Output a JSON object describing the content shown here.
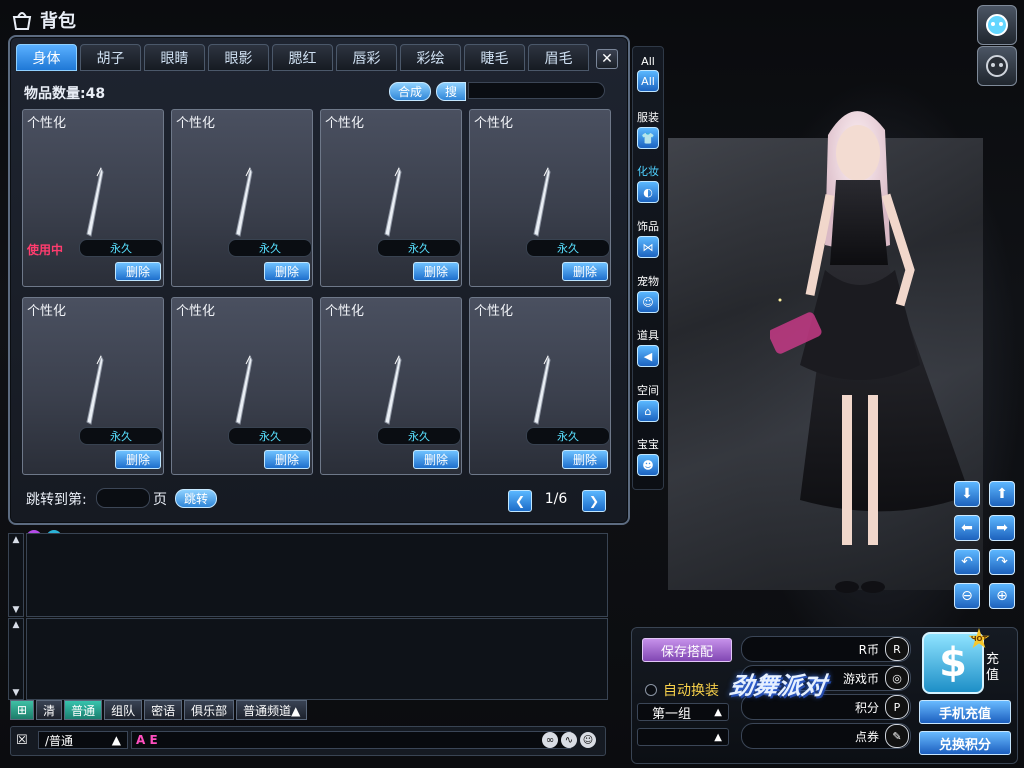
{
  "window": {
    "title": "背包"
  },
  "tabs": [
    {
      "label": "身体",
      "active": true
    },
    {
      "label": "胡子",
      "active": false
    },
    {
      "label": "眼睛",
      "active": false
    },
    {
      "label": "眼影",
      "active": false
    },
    {
      "label": "腮红",
      "active": false
    },
    {
      "label": "唇彩",
      "active": false
    },
    {
      "label": "彩绘",
      "active": false
    },
    {
      "label": "睫毛",
      "active": false
    },
    {
      "label": "眉毛",
      "active": false
    }
  ],
  "close_glyph": "✕",
  "item_count": "物品数量:48",
  "toolbar": {
    "combine": "合成",
    "search": "搜"
  },
  "items": [
    {
      "label": "个性化",
      "status": "使用中",
      "duration": "永久",
      "delete": "删除"
    },
    {
      "label": "个性化",
      "status": "",
      "duration": "永久",
      "delete": "删除"
    },
    {
      "label": "个性化",
      "status": "",
      "duration": "永久",
      "delete": "删除"
    },
    {
      "label": "个性化",
      "status": "",
      "duration": "永久",
      "delete": "删除"
    },
    {
      "label": "个性化",
      "status": "",
      "duration": "永久",
      "delete": "删除"
    },
    {
      "label": "个性化",
      "status": "",
      "duration": "永久",
      "delete": "删除"
    },
    {
      "label": "个性化",
      "status": "",
      "duration": "永久",
      "delete": "删除"
    },
    {
      "label": "个性化",
      "status": "",
      "duration": "永久",
      "delete": "删除"
    }
  ],
  "pagination": {
    "jump_label": "跳转到第:",
    "page_unit": "页",
    "jump_button": "跳转",
    "indicator": "1/6"
  },
  "categories": [
    {
      "label": "All",
      "icon": "all-icon",
      "glyph": "All",
      "active": false
    },
    {
      "label": "服装",
      "icon": "shirt-icon",
      "glyph": "👕",
      "active": false
    },
    {
      "label": "化妆",
      "icon": "makeup-icon",
      "glyph": "◐",
      "active": true
    },
    {
      "label": "饰品",
      "icon": "bow-icon",
      "glyph": "⋈",
      "active": false
    },
    {
      "label": "宠物",
      "icon": "pet-icon",
      "glyph": "☺",
      "active": false
    },
    {
      "label": "道具",
      "icon": "megaphone-icon",
      "glyph": "◀",
      "active": false
    },
    {
      "label": "空间",
      "icon": "house-icon",
      "glyph": "⌂",
      "active": false
    },
    {
      "label": "宝宝",
      "icon": "baby-icon",
      "glyph": "☻",
      "active": false
    }
  ],
  "camera_controls": [
    {
      "name": "move-down",
      "glyph": "⬇"
    },
    {
      "name": "move-up",
      "glyph": "⬆"
    },
    {
      "name": "move-left",
      "glyph": "⬅"
    },
    {
      "name": "move-right",
      "glyph": "➡"
    },
    {
      "name": "rotate-left",
      "glyph": "↶"
    },
    {
      "name": "rotate-right",
      "glyph": "↷"
    },
    {
      "name": "zoom-out",
      "glyph": "⊖"
    },
    {
      "name": "zoom-in",
      "glyph": "⊕"
    }
  ],
  "chat": {
    "tabs": [
      {
        "label": "清",
        "active": false
      },
      {
        "label": "普通",
        "active": true
      },
      {
        "label": "组队",
        "active": false
      },
      {
        "label": "密语",
        "active": false
      },
      {
        "label": "俱乐部",
        "active": false
      },
      {
        "label": "普通频道▲",
        "active": false
      }
    ],
    "channel": "/普通",
    "channel_arrow": "▲",
    "input_markers": "A E"
  },
  "outfit": {
    "save_button": "保存搭配",
    "auto_dress": "自动换装",
    "group_select": "第一组",
    "group_arrow": "▲"
  },
  "currencies": [
    {
      "label": "R币",
      "icon": "rcoin-icon",
      "glyph": "R"
    },
    {
      "label": "游戏币",
      "icon": "gamecoin-icon",
      "glyph": "◎"
    },
    {
      "label": "积分",
      "icon": "points-icon",
      "glyph": "P"
    },
    {
      "label": "点券",
      "icon": "voucher-icon",
      "glyph": "✎"
    }
  ],
  "recharge": {
    "symbol": "$",
    "label": "充值",
    "badge": "HOT"
  },
  "actions": {
    "mobile_recharge": "手机充值",
    "redeem_points": "兑换积分"
  },
  "logo_text": "劲舞派对",
  "colors": {
    "accent_blue": "#2f86d8",
    "in_use_red": "#ff3c6e",
    "duration_cyan": "#58e0ff",
    "auto_dress_yellow": "#f7d04a",
    "save_purple": "#8147b3"
  }
}
